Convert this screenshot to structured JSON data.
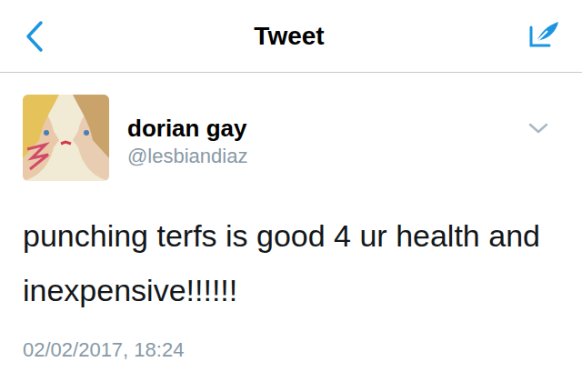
{
  "nav": {
    "title": "Tweet"
  },
  "tweet": {
    "name": "dorian gay",
    "handle": "@lesbiandiaz",
    "text": "punching terfs is good 4 ur health and inexpensive!!!!!!",
    "timestamp": "02/02/2017, 18:24"
  }
}
